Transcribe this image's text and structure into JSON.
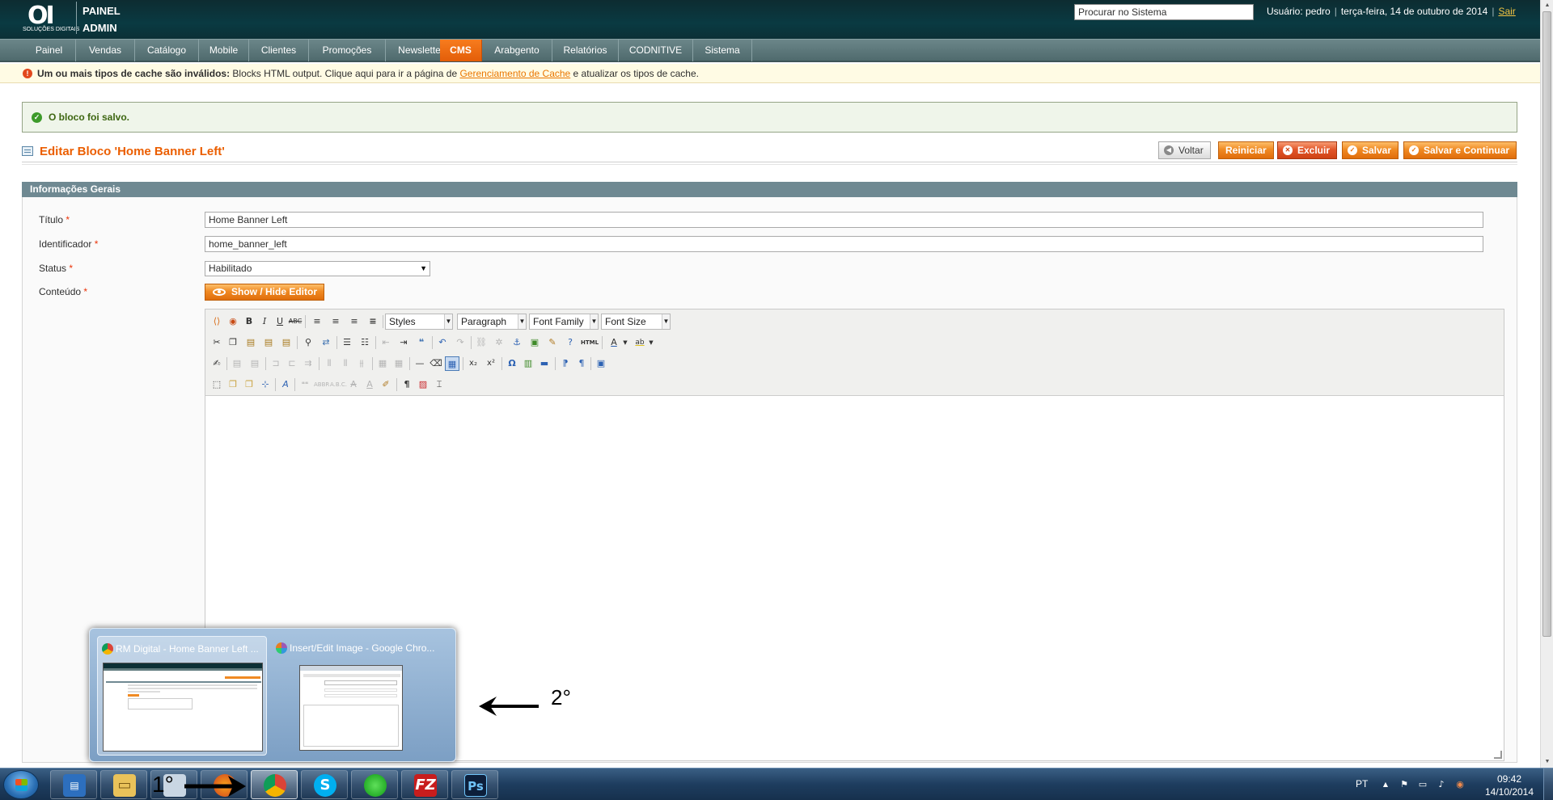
{
  "header": {
    "logo_mark": "OI",
    "logo_sub": "SOLUÇÕES DIGITAIS",
    "brand_line1": "PAINEL",
    "brand_line2": "ADMIN",
    "search_placeholder": "Procurar no Sistema",
    "user": "Usuário: pedro",
    "date": "terça-feira, 14 de outubro de 2014",
    "logout": "Sair"
  },
  "nav": [
    {
      "label": "Painel"
    },
    {
      "label": "Vendas"
    },
    {
      "label": "Catálogo"
    },
    {
      "label": "Mobile"
    },
    {
      "label": "Clientes"
    },
    {
      "label": "Promoções"
    },
    {
      "label": "Newsletter"
    },
    {
      "label": "CMS",
      "active": true
    },
    {
      "label": "Arabgento"
    },
    {
      "label": "Relatórios"
    },
    {
      "label": "CODNITIVE"
    },
    {
      "label": "Sistema"
    }
  ],
  "notice": {
    "bold": "Um ou mais tipos de cache são inválidos:",
    "text1": " Blocks HTML output. Clique aqui para ir a página de ",
    "link": "Gerenciamento de Cache",
    "text2": " e atualizar os tipos de cache."
  },
  "success": "O bloco foi salvo.",
  "page": {
    "title": "Editar Bloco 'Home Banner Left'",
    "buttons": {
      "back": "Voltar",
      "reset": "Reiniciar",
      "delete": "Excluir",
      "save": "Salvar",
      "save_continue": "Salvar e Continuar"
    }
  },
  "form": {
    "section": "Informações Gerais",
    "title_label": "Título",
    "title_value": "Home Banner Left",
    "identifier_label": "Identificador",
    "identifier_value": "home_banner_left",
    "status_label": "Status",
    "status_value": "Habilitado",
    "content_label": "Conteúdo",
    "required": "*",
    "toggle_editor": "Show / Hide Editor"
  },
  "editor": {
    "styles": "Styles",
    "format": "Paragraph",
    "font_family": "Font Family",
    "font_size": "Font Size",
    "html_label": "HTML"
  },
  "taskbar": {
    "language": "PT",
    "time": "09:42",
    "date": "14/10/2014"
  },
  "thumbnails": [
    {
      "title": "RM Digital - Home Banner Left ..."
    },
    {
      "title": "Insert/Edit Image - Google Chro..."
    }
  ],
  "annotations": {
    "first": "1°",
    "second": "2°"
  },
  "colors": {
    "accent": "#eb5e00",
    "nav_active": "#f0740f",
    "header_bg": "#0b3036"
  }
}
